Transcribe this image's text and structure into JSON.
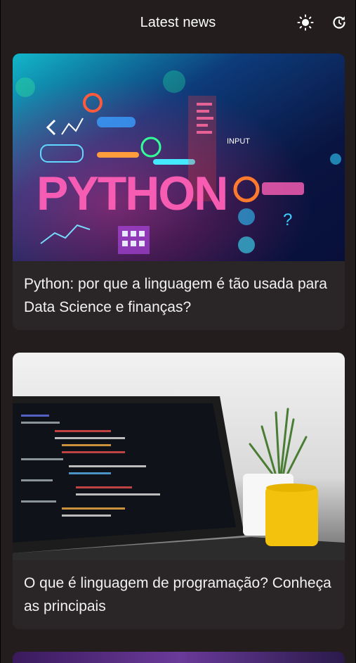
{
  "header": {
    "title": "Latest news",
    "theme_icon": "sun-icon",
    "refresh_icon": "refresh-icon"
  },
  "articles": [
    {
      "title": "Python: por que a linguagem é tão usada para Data Science e finanças?",
      "image_text": "PYTHON",
      "image_secondary_text": "INPUT"
    },
    {
      "title": "O que é linguagem de programação? Conheça as principais"
    },
    {
      "title": ""
    }
  ],
  "colors": {
    "background": "#231d1d",
    "card": "#2a2526",
    "text": "#ffffff",
    "python_glow": "#ff4fb0",
    "python_bg": "#0b1a44",
    "mug_yellow": "#f2c20d"
  }
}
